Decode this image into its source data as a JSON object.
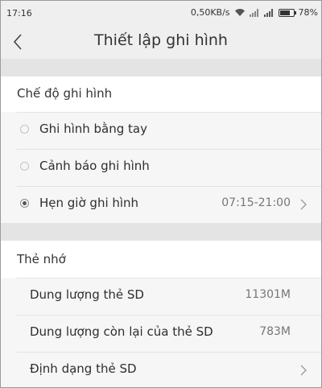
{
  "status_bar": {
    "time": "17:16",
    "network_speed": "0,50KB/s",
    "battery_percent": "78%",
    "battery_level": 0.78,
    "icons": [
      "wifi-icon",
      "signal-icon",
      "signal-icon",
      "battery-icon"
    ]
  },
  "header": {
    "title": "Thiết lập ghi hình",
    "back_icon": "back-arrow-icon"
  },
  "recording_mode": {
    "section_label": "Chế độ ghi hình",
    "options": [
      {
        "label": "Ghi hình bằng tay",
        "selected": false
      },
      {
        "label": "Cảnh báo ghi hình",
        "selected": false
      },
      {
        "label": "Hẹn giờ ghi hình",
        "selected": true,
        "value": "07:15-21:00"
      }
    ]
  },
  "memory_card": {
    "section_label": "Thẻ nhớ",
    "rows": [
      {
        "label": "Dung lượng thẻ SD",
        "value": "11301M"
      },
      {
        "label": "Dung lượng còn lại của thẻ SD",
        "value": "783M"
      },
      {
        "label": "Định dạng thẻ SD",
        "value": ""
      }
    ]
  },
  "colors": {
    "background": "#ffffff",
    "band": "#e4e4e4",
    "row": "#f6f6f6",
    "text": "#2e2e2e",
    "secondary_text": "#777777"
  }
}
